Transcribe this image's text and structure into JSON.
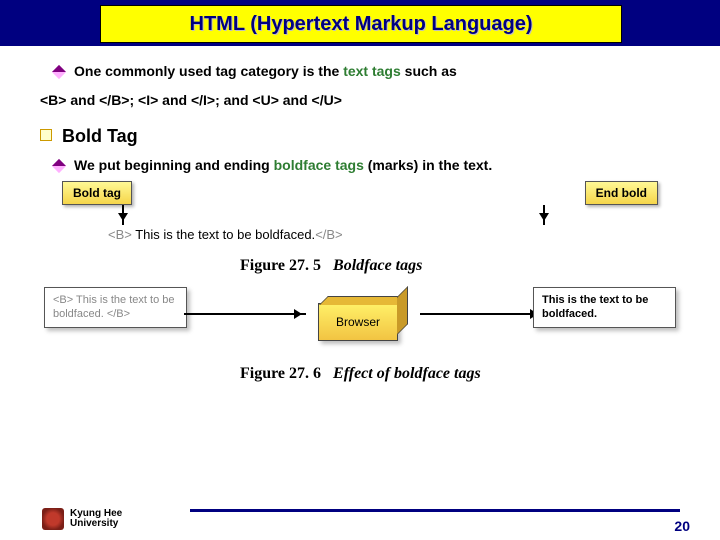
{
  "title": "HTML (Hypertext Markup Language)",
  "line1a": "One commonly used tag category is the ",
  "line1b": "text tags",
  "line1c": " such as",
  "line2": "<B> and </B>; <I> and </I>; and <U> and </U>",
  "h2": "Bold Tag",
  "line3a": "We put beginning and ending ",
  "line3b": "boldface tags",
  "line3c": " (marks) in the text.",
  "fig1": {
    "label_left": "Bold tag",
    "label_right": "End bold",
    "open_tag": "<B>",
    "mid_text": " This is the text to be boldfaced.",
    "close_tag": "</B>",
    "caption_num": "Figure 27. 5",
    "caption_txt": "Boldface tags"
  },
  "fig2": {
    "card_left": "<B> This is the text to be boldfaced. </B>",
    "browser": "Browser",
    "card_right_a": "This is",
    "card_right_b": " the text to be boldfaced.",
    "caption_num": "Figure 27. 6",
    "caption_txt": "Effect of boldface tags"
  },
  "footer": {
    "uni1": "Kyung Hee",
    "uni2": "University",
    "page": "20"
  }
}
